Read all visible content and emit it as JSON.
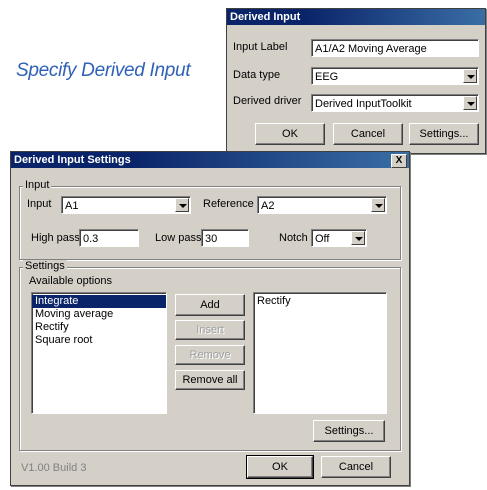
{
  "caption": "Specify Derived Input",
  "small_dialog": {
    "title": "Derived Input",
    "input_label_label": "Input Label",
    "input_label_value": "A1/A2 Moving Average",
    "data_type_label": "Data type",
    "data_type_value": "EEG",
    "derived_driver_label": "Derived driver",
    "derived_driver_value": "Derived InputToolkit",
    "ok_label": "OK",
    "cancel_label": "Cancel",
    "settings_label": "Settings..."
  },
  "main_dialog": {
    "title": "Derived Input Settings",
    "close_label": "X",
    "input_group_label": "Input",
    "input_label": "Input",
    "input_value": "A1",
    "reference_label": "Reference",
    "reference_value": "A2",
    "highpass_label": "High pass",
    "highpass_value": "0.3",
    "lowpass_label": "Low pass",
    "lowpass_value": "30",
    "notch_label": "Notch",
    "notch_value": "Off",
    "settings_group_label": "Settings",
    "available_label": "Available options",
    "available_options": [
      "Integrate",
      "Moving average",
      "Rectify",
      "Square root"
    ],
    "selected_options": [
      "Rectify"
    ],
    "add_label": "Add",
    "insert_label": "Insert",
    "remove_label": "Remove",
    "remove_all_label": "Remove all",
    "settings_btn_label": "Settings...",
    "version": "V1.00 Build 3",
    "ok_label": "OK",
    "cancel_label": "Cancel"
  }
}
